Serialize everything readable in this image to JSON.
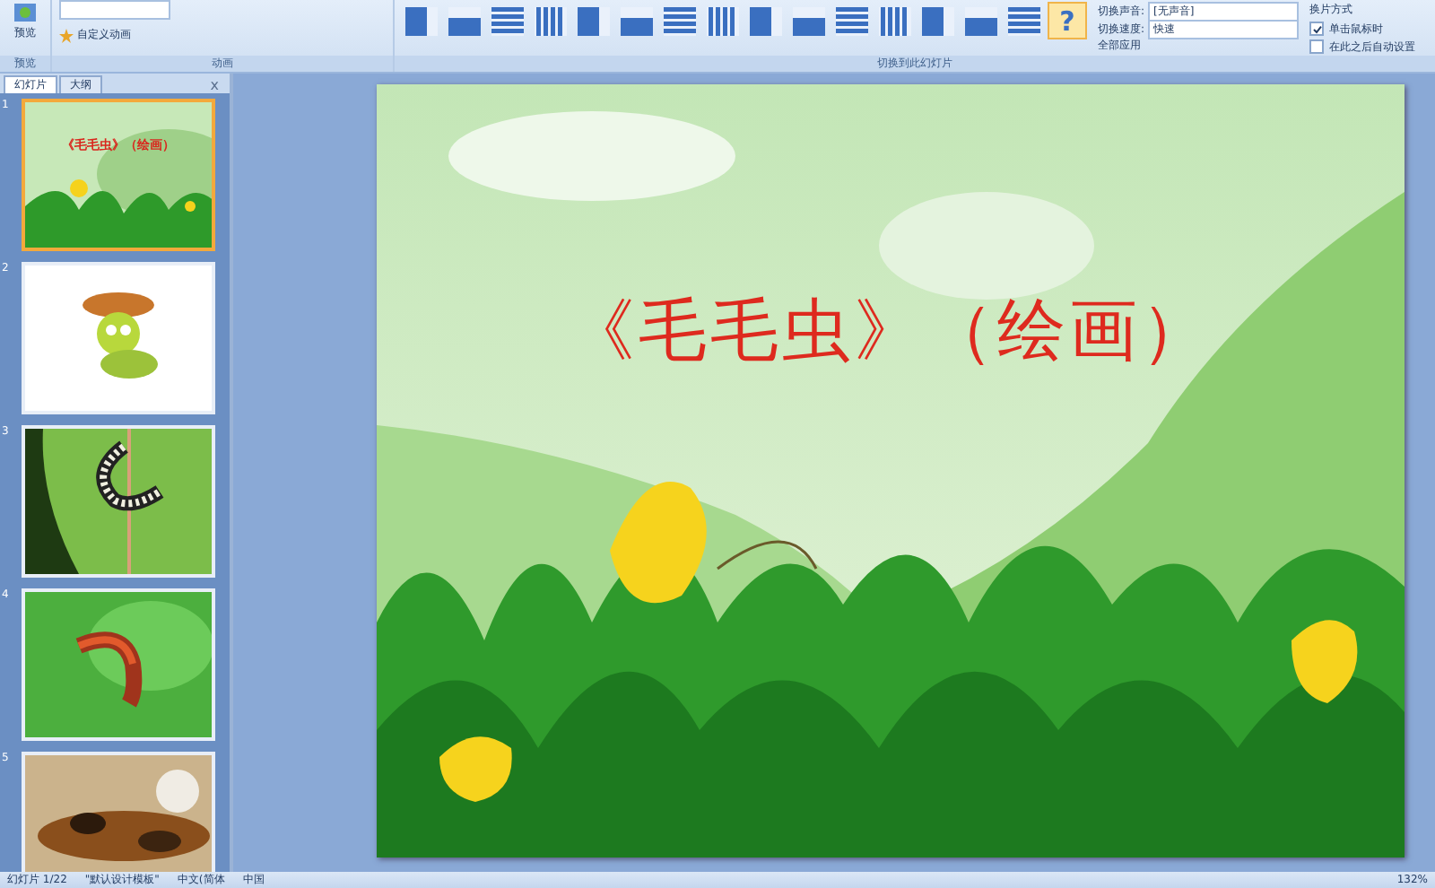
{
  "ribbon": {
    "preview": {
      "label": "预览",
      "group": "预览"
    },
    "animation": {
      "custom_animation": "自定义动画",
      "group": "动画"
    },
    "transitions": {
      "group": "切换到此幻灯片",
      "items": [
        {
          "selected": false
        },
        {
          "selected": false
        },
        {
          "selected": false
        },
        {
          "selected": false
        },
        {
          "selected": false
        },
        {
          "selected": false
        },
        {
          "selected": false
        },
        {
          "selected": false
        },
        {
          "selected": false
        },
        {
          "selected": false
        },
        {
          "selected": false
        },
        {
          "selected": false
        },
        {
          "selected": false
        },
        {
          "selected": false
        },
        {
          "selected": false
        },
        {
          "selected": true,
          "label": "?"
        }
      ]
    },
    "sound": {
      "label": "切换声音:",
      "value": "[无声音]"
    },
    "speed": {
      "label": "切换速度:",
      "value": "快速"
    },
    "apply_all": "全部应用",
    "advance": {
      "title": "换片方式",
      "options": [
        {
          "label": "单击鼠标时",
          "checked": true
        },
        {
          "label": "在此之后自动设置",
          "checked": false
        }
      ]
    }
  },
  "panel": {
    "tabs": [
      {
        "label": "幻灯片",
        "selected": true
      },
      {
        "label": "大纲",
        "selected": false
      }
    ],
    "close": "x",
    "slides": [
      {
        "number": "1",
        "selected": true,
        "kind": "title",
        "title": "《毛毛虫》（绘画）"
      },
      {
        "number": "2",
        "selected": false,
        "kind": "cartoon"
      },
      {
        "number": "3",
        "selected": false,
        "kind": "leaf"
      },
      {
        "number": "4",
        "selected": false,
        "kind": "green"
      },
      {
        "number": "5",
        "selected": false,
        "kind": "fuzzy"
      }
    ]
  },
  "slide": {
    "title": "《毛毛虫》（绘画）"
  },
  "status_bar": {
    "slide": "幻灯片 1/22",
    "theme": "\"默认设计模板\"",
    "language": "中文(简体",
    "region": "中国",
    "zoom": "132%"
  }
}
